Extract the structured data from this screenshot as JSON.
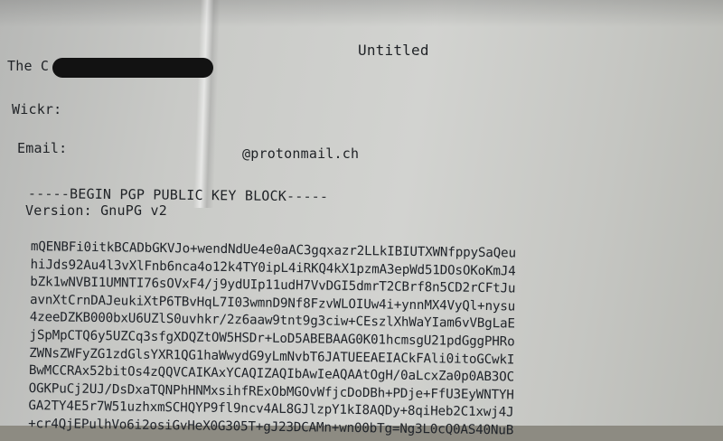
{
  "doc": {
    "title": "Untitled",
    "line_the": "The C",
    "line_wickr": "Wickr:",
    "line_email_label": "Email:",
    "line_email_value": "@protonmail.ch",
    "pgp_begin": "-----BEGIN PGP PUBLIC KEY BLOCK-----",
    "pgp_version": "Version: GnuPG v2",
    "key_lines": [
      "mQENBFi0itkBCADbGKVJo+wendNdUe4e0aAC3gqxazr2LLkIBIUTXWNfppySaQeu",
      "hiJds92Au4l3vXlFnb6nca4o12k4TY0ipL4iRKQ4kX1pzmA3epWd51DOsOKoKmJ4",
      "bZk1wNVBI1UMNTI76sOVxF4/j9ydUIp11udH7VvDGI5dmrT2CBrf8n5CD2rCFtJu",
      "avnXtCrnDAJeukiXtP6TBvHqL7I03wmnD9Nf8FzvWLOIUw4i+ynnMX4VyQl+nysu",
      "4zeeDZKB000bxU6UZlS0uvhkr/2z6aaw9tnt9g3ciw+CEszlXhWaYIam6vVBgLaE",
      "jSpMpCTQ6y5UZCq3sfgXDQZtOW5HSDr+LoD5ABEBAAG0K01hcmsgU21pdGggPHRo",
      "ZWNsZWFyZG1zdGlsYXR1QG1haWwydG9yLmNvbT6JATUEEAEIACkFAli0itoGCwkI",
      "BwMCCRAx52bitOs4zQQVCAIKAxYCAQIZAQIbAwIeAQAAtOgH/0aLcxZa0p0AB3OC",
      "OGKPuCj2UJ/DsDxaTQNPhHNMxsihfRExObMGOvWfjcDoDBh+PDje+FfU3EyWNTYH",
      "GA2TY4E5r7W51uzhxmSCHQYP9fl9ncv4AL8GJlzpY1kI8AQDy+8qiHeb2C1xwj4J",
      "+cr4QjEPulhVo6i2osiGvHeX0G305T+gJ23DCAMn+wn00bTg=Ng3L0cQ0AS40NuB"
    ]
  }
}
